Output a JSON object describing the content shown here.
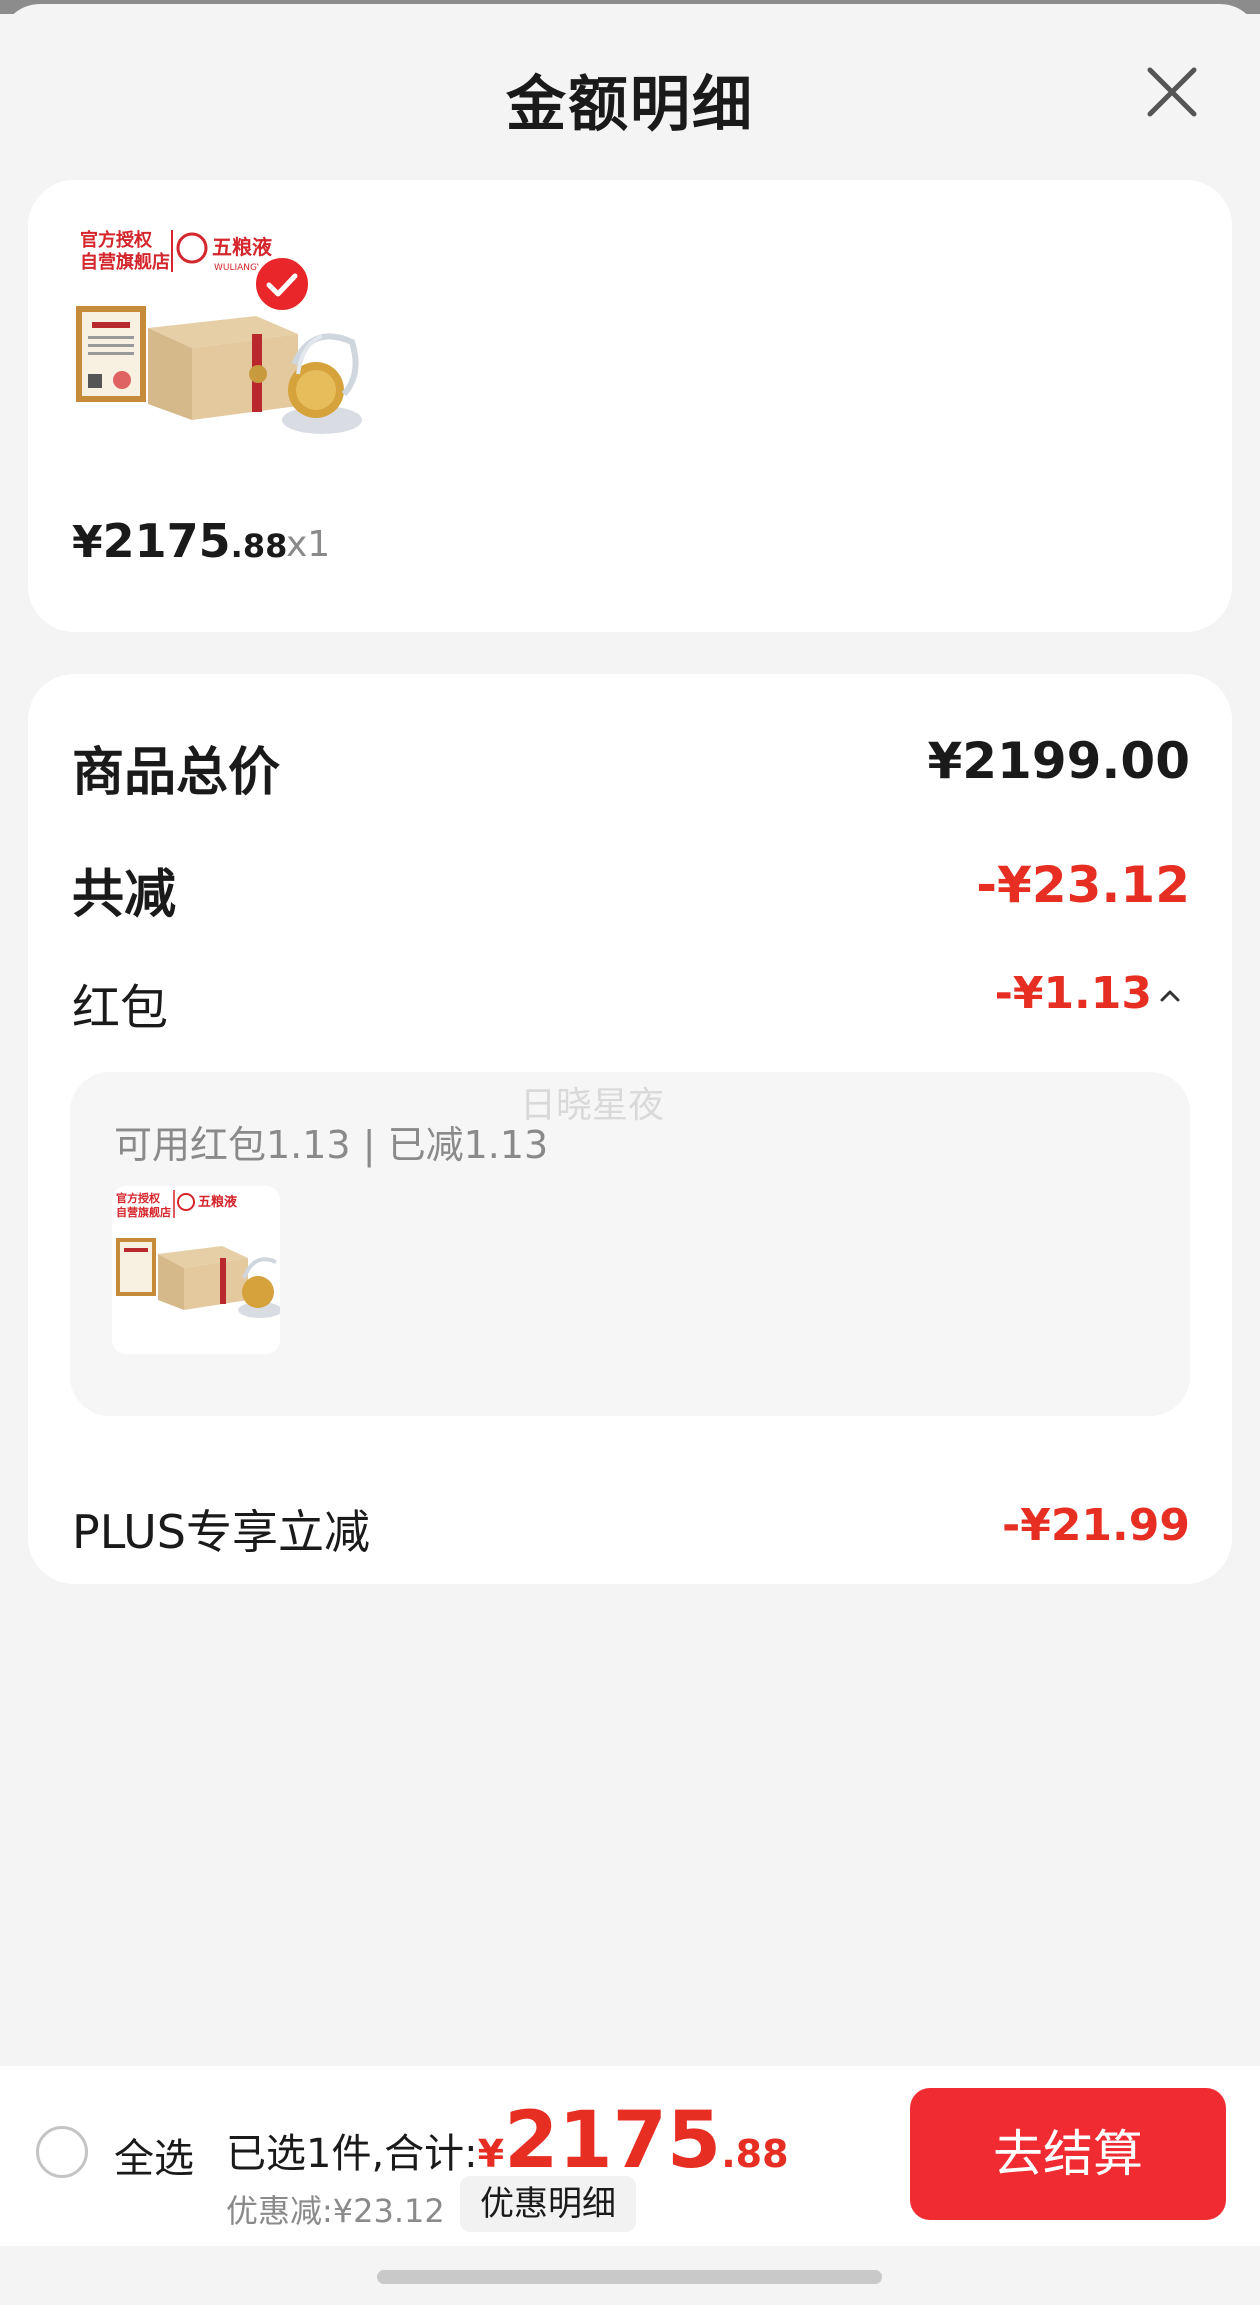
{
  "header": {
    "title": "金额明细",
    "close_icon": "close-icon"
  },
  "product": {
    "price_currency": "¥",
    "price_integer": "2175",
    "price_decimal": ".88",
    "quantity": "x1",
    "logo_text_1": "官方授权",
    "logo_text_2": "自营旗舰店",
    "brand": "五粮液",
    "brand_en": "WULIANGYE",
    "selected": true
  },
  "summary": {
    "total_label": "商品总价",
    "total_value": "¥2199.00",
    "reduce_label": "共减",
    "reduce_value": "-¥23.12",
    "hongbao_label": "红包",
    "hongbao_value": "-¥1.13",
    "hongbao_detail": "可用红包1.13 | 已减1.13",
    "plus_label": "PLUS专享立减",
    "plus_value": "-¥21.99"
  },
  "watermark": "日晓星夜",
  "bottom": {
    "select_all": "全选",
    "selected_label": "已选1件,合计:",
    "currency": "¥",
    "amount_integer": "2175",
    "amount_decimal": ".88",
    "discount": "优惠减:¥23.12",
    "detail_button": "优惠明细",
    "checkout_button": "去结算"
  },
  "colors": {
    "accent": "#e62e23",
    "checkout": "#f02b32"
  }
}
